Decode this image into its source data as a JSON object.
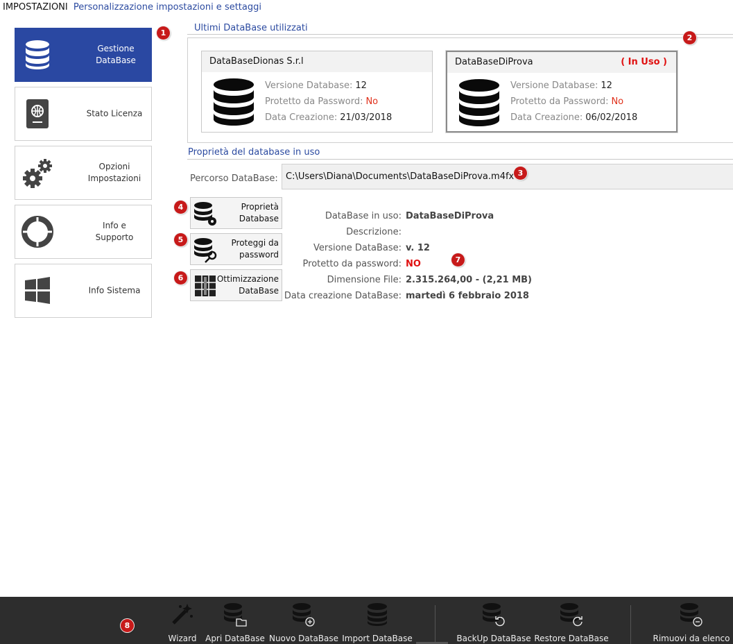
{
  "header": {
    "title": "IMPOSTAZIONI",
    "subtitle": "Personalizzazione impostazioni e settaggi"
  },
  "nav": [
    {
      "label": "Gestione DataBase",
      "icon": "database-icon",
      "active": true
    },
    {
      "label": "Stato Licenza",
      "icon": "passport-icon",
      "active": false
    },
    {
      "label": "Opzioni Impostazioni",
      "icon": "gears-icon",
      "active": false
    },
    {
      "label": "Info e Supporto",
      "icon": "lifebuoy-icon",
      "active": false
    },
    {
      "label": "Info Sistema",
      "icon": "windows-icon",
      "active": false
    }
  ],
  "badges": [
    "1",
    "2",
    "3",
    "4",
    "5",
    "6",
    "7",
    "8"
  ],
  "recent": {
    "title": "Ultimi DataBase utilizzati",
    "cards": [
      {
        "name": "DataBaseDionas S.r.l",
        "in_use_label": "",
        "version_label": "Versione Database:",
        "version": "12",
        "pwd_label": "Protetto da Password:",
        "pwd": "No",
        "date_label": "Data Creazione:",
        "date": "21/03/2018"
      },
      {
        "name": "DataBaseDiProva",
        "in_use_label": "( In Uso )",
        "version_label": "Versione Database:",
        "version": "12",
        "pwd_label": "Protetto da Password:",
        "pwd": "No",
        "date_label": "Data Creazione:",
        "date": "06/02/2018"
      }
    ]
  },
  "props": {
    "title": "Proprietà del database in uso",
    "path_label": "Percorso DataBase:",
    "path_value": "C:\\Users\\Diana\\Documents\\DataBaseDiProva.m4fx",
    "actions": [
      {
        "label": "Proprietà Database",
        "icon": "database-gear-icon"
      },
      {
        "label": "Proteggi da password",
        "icon": "database-key-icon"
      },
      {
        "label": "Ottimizzazione DataBase",
        "icon": "compress-archive-icon"
      }
    ],
    "rows": [
      {
        "key": "DataBase in uso:",
        "value": "DataBaseDiProva"
      },
      {
        "key": "Descrizione:",
        "value": ""
      },
      {
        "key": "Versione DataBase:",
        "value": "v. 12"
      },
      {
        "key": "Protetto da password:",
        "value": "NO"
      },
      {
        "key": "Dimensione File:",
        "value": "2.315.264,00 - (2,21 MB)"
      },
      {
        "key": "Data creazione DataBase:",
        "value": "martedì 6 febbraio 2018"
      }
    ]
  },
  "toolbar": [
    {
      "label": "Wizard",
      "icon": "magic-wand-icon"
    },
    {
      "label": "Apri DataBase",
      "icon": "database-open-icon"
    },
    {
      "label": "Nuovo DataBase",
      "icon": "database-add-icon"
    },
    {
      "label": "Import DataBase",
      "icon": "database-import-icon"
    },
    {
      "label": "BackUp DataBase",
      "icon": "database-backup-icon"
    },
    {
      "label": "Restore DataBase",
      "icon": "database-restore-icon"
    },
    {
      "label": "Rimuovi da elenco",
      "icon": "database-remove-icon"
    }
  ],
  "colors": {
    "accent": "#2a48a2",
    "badge": "#c71a1a",
    "alert": "#e01010",
    "toolbar_bg": "#2d2d2d"
  }
}
